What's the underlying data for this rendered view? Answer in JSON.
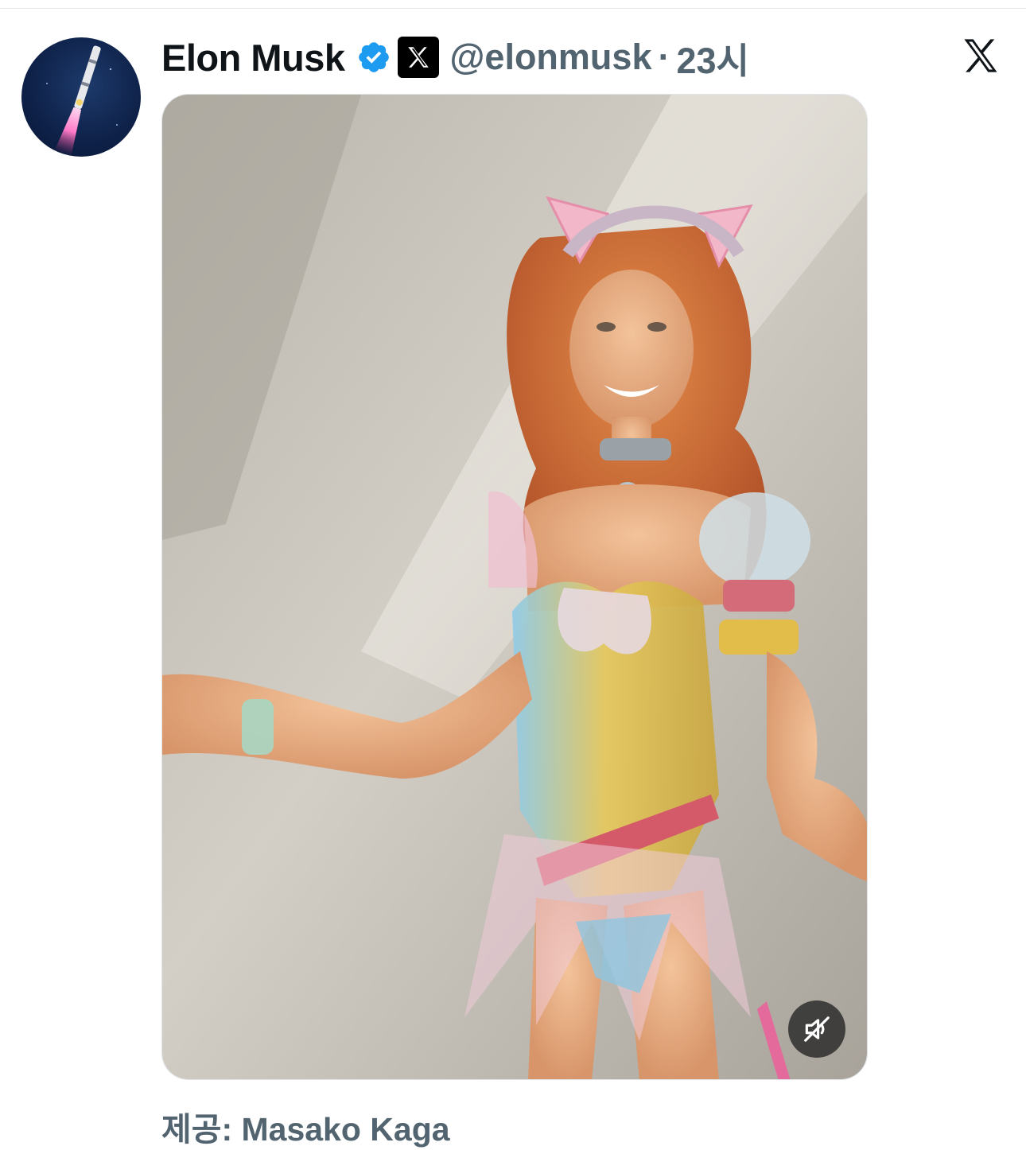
{
  "post": {
    "author_name": "Elon Musk",
    "handle": "@elonmusk",
    "separator": "·",
    "time": "23시",
    "verified_icon": "verified-badge-icon",
    "affiliate_icon": "x-affiliate-badge-icon",
    "platform_icon": "x-logo-icon"
  },
  "media": {
    "mute_icon": "muted-speaker-icon",
    "credit": "제공: Masako Kaga"
  },
  "colors": {
    "verified_blue": "#1d9bf0",
    "secondary_text": "#536471",
    "primary_text": "#0f1419"
  }
}
